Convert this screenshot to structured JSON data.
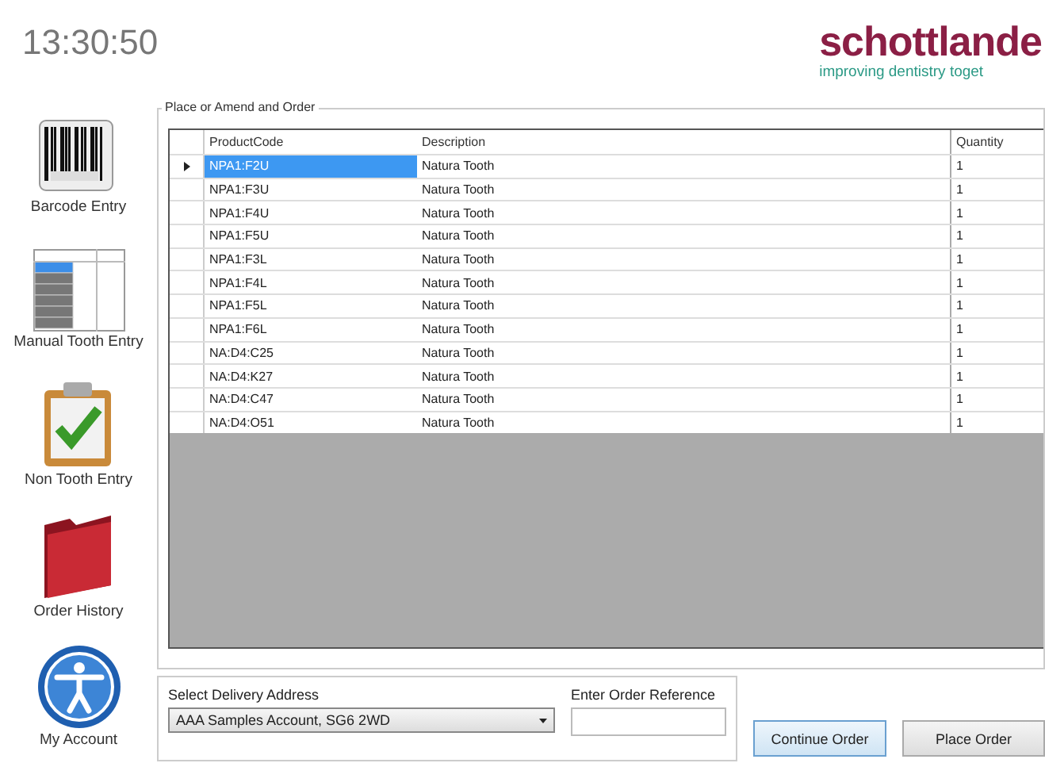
{
  "clock": "13:30:50",
  "logo": {
    "name": "schottlande",
    "tagline": "improving dentistry toget"
  },
  "sidebar": {
    "items": [
      {
        "label": "Barcode Entry",
        "kind": "barcode"
      },
      {
        "label": "Manual Tooth Entry",
        "kind": "grid"
      },
      {
        "label": "Non Tooth Entry",
        "kind": "clipboard"
      },
      {
        "label": "Order History",
        "kind": "folder"
      },
      {
        "label": "My Account",
        "kind": "person"
      }
    ]
  },
  "order": {
    "title": "Place or Amend and Order",
    "columns": [
      "ProductCode",
      "Description",
      "Quantity"
    ],
    "rows": [
      {
        "cells": [
          "NPA1:F2U",
          "Natura Tooth",
          "1"
        ],
        "selected": true
      },
      {
        "cells": [
          "NPA1:F3U",
          "Natura Tooth",
          "1"
        ],
        "selected": false
      },
      {
        "cells": [
          "NPA1:F4U",
          "Natura Tooth",
          "1"
        ],
        "selected": false
      },
      {
        "cells": [
          "NPA1:F5U",
          "Natura Tooth",
          "1"
        ],
        "selected": false
      },
      {
        "cells": [
          "NPA1:F3L",
          "Natura Tooth",
          "1"
        ],
        "selected": false
      },
      {
        "cells": [
          "NPA1:F4L",
          "Natura Tooth",
          "1"
        ],
        "selected": false
      },
      {
        "cells": [
          "NPA1:F5L",
          "Natura Tooth",
          "1"
        ],
        "selected": false
      },
      {
        "cells": [
          "NPA1:F6L",
          "Natura Tooth",
          "1"
        ],
        "selected": false
      },
      {
        "cells": [
          "NA:D4:C25",
          "Natura Tooth",
          "1"
        ],
        "selected": false
      },
      {
        "cells": [
          "NA:D4:K27",
          "Natura Tooth",
          "1"
        ],
        "selected": false
      },
      {
        "cells": [
          "NA:D4:C47",
          "Natura Tooth",
          "1"
        ],
        "selected": false
      },
      {
        "cells": [
          "NA:D4:O51",
          "Natura Tooth",
          "1"
        ],
        "selected": false
      }
    ]
  },
  "delivery": {
    "label": "Select Delivery Address",
    "value": "AAA Samples Account, SG6 2WD"
  },
  "reference": {
    "label": "Enter Order Reference"
  },
  "buttons": [
    "Continue Order",
    "Place Order"
  ]
}
